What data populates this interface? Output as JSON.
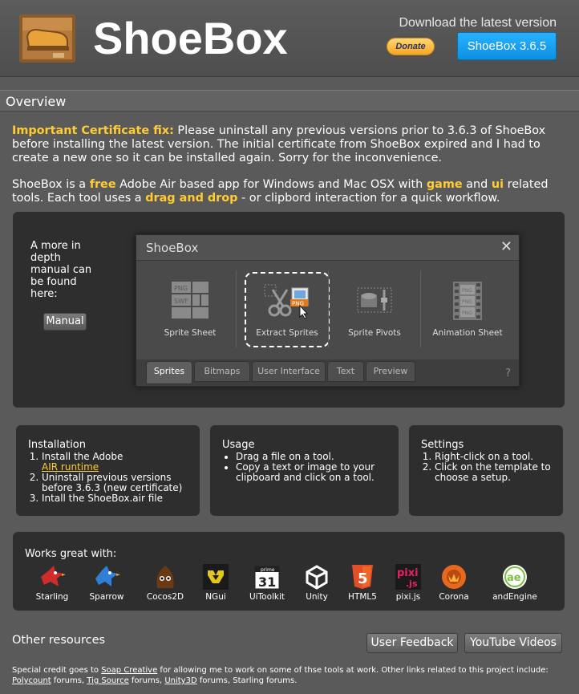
{
  "header": {
    "brand": "ShoeBox",
    "download_text": "Download the latest version",
    "donate_label": "Donate",
    "version_label": "ShoeBox 3.6.5"
  },
  "overview": {
    "title": "Overview",
    "cert_fix_label": "Important Certificate fix:",
    "cert_fix_text": " Please uninstall any previous versions prior to 3.6.3 of ShoeBox before installing the latest version. The initial certificate from ShoeBox expired and I had to create a new one so it can be installed again. Sorry for the inconvenience.",
    "intro": {
      "t1": "ShoeBox is a ",
      "free": "free",
      "t2": " Adobe Air based app for Windows and Mac OSX with ",
      "game": "game",
      "t3": " and ",
      "ui": "ui",
      "t4": " related tools. Each tool uses a ",
      "dnd": "drag and drop",
      "t5": " - or clipbord interaction for a quick workflow."
    }
  },
  "demo": {
    "manual_text": "A more in depth manual can be found here:",
    "manual_button": "Manual",
    "window_title": "ShoeBox",
    "close_glyph": "✕",
    "tools": [
      {
        "label": "Sprite Sheet"
      },
      {
        "label": "Extract Sprites"
      },
      {
        "label": "Sprite Pivots"
      },
      {
        "label": "Animation Sheet"
      }
    ],
    "tabs": [
      "Sprites",
      "Bitmaps",
      "User Interface",
      "Text",
      "Preview"
    ],
    "help_glyph": "?"
  },
  "installation": {
    "title": "Installation",
    "step1_text": "Install the Adobe",
    "step1_link": "AIR runtime",
    "step2": "Uninstall previous versions before 3.6.3 (new certificate)",
    "step3": "Intall the ShoeBox.air file"
  },
  "usage": {
    "title": "Usage",
    "items": [
      "Drag a file on a tool.",
      "Copy a text or image to your clipboard and click on a tool."
    ]
  },
  "settings": {
    "title": "Settings",
    "items": [
      "Right-click on a tool.",
      "Click on the template to choose a setup."
    ]
  },
  "works_with": {
    "title": "Works great with:",
    "engines": [
      "Starling",
      "Sparrow",
      "Cocos2D",
      "NGui",
      "UiToolkit",
      "Unity",
      "HTML5",
      "pixi.js",
      "Corona",
      "andEngine"
    ]
  },
  "resources": {
    "title": "Other resources",
    "feedback_button": "User Feedback",
    "youtube_button": "YouTube Videos"
  },
  "credits": {
    "t1": "Special credit goes to ",
    "soap": "Soap Creative",
    "t2": " for allowing me to work on some of thse tools at work. Other links related to this project include: ",
    "polycount": "Polycount",
    "t3": " forums, ",
    "tig": "Tig Source",
    "t4": " forums, ",
    "unity3d": "Unity3D",
    "t5": " forums, Starling forums."
  },
  "colors": {
    "accent_yellow": "#ffcc33",
    "version_blue": "#1a9ff0",
    "panel_dark": "#2e2e2e",
    "page_bg": "#5a5a5a"
  }
}
